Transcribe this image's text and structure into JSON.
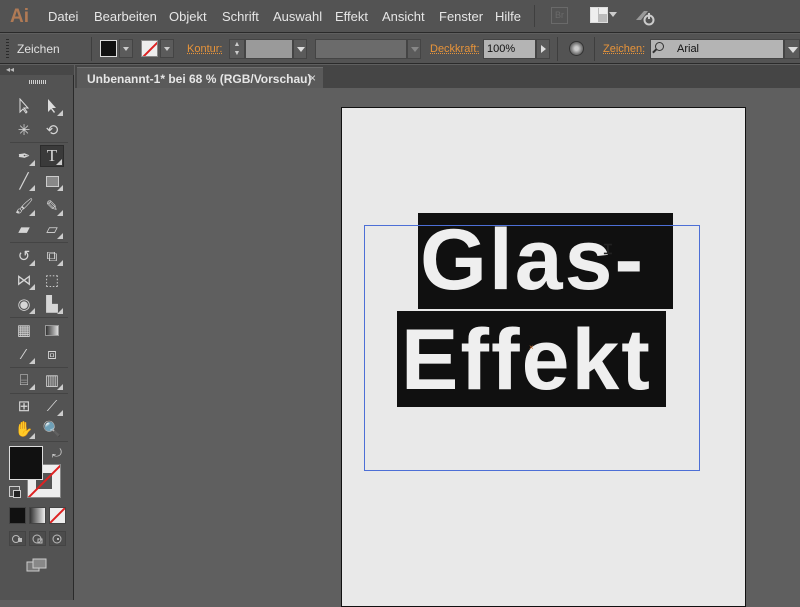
{
  "app": {
    "logo": "Ai"
  },
  "menu": {
    "items": [
      "Datei",
      "Bearbeiten",
      "Objekt",
      "Schrift",
      "Auswahl",
      "Effekt",
      "Ansicht",
      "Fenster",
      "Hilfe"
    ],
    "bridge": "Br"
  },
  "control_bar": {
    "label": "Zeichen",
    "fill_color": "#111111",
    "stroke_color": "none",
    "kontur_label": "Kontur:",
    "kontur_value": "",
    "deckkraft_label": "Deckkraft:",
    "deckkraft_value": "100%",
    "zeichen_label": "Zeichen:",
    "font_value": "Arial"
  },
  "tools_panel": {
    "collapse": "◂◂",
    "tools": [
      "selection-tool",
      "direct-selection-tool",
      "magic-wand-tool",
      "lasso-tool",
      "pen-tool",
      "type-tool",
      "line-tool",
      "rectangle-tool",
      "paintbrush-tool",
      "pencil-tool",
      "blob-brush-tool",
      "eraser-tool",
      "rotate-tool",
      "scale-tool",
      "width-tool",
      "free-transform-tool",
      "shape-builder-tool",
      "perspective-grid-tool",
      "mesh-tool",
      "gradient-tool",
      "eyedropper-tool",
      "blend-tool",
      "symbol-sprayer-tool",
      "column-graph-tool",
      "artboard-tool",
      "slice-tool",
      "hand-tool",
      "zoom-tool"
    ],
    "active_tool": "type-tool",
    "fill_color": "#111111",
    "stroke_color": "none"
  },
  "document": {
    "tab_title": "Unbenannt-1* bei 68 % (RGB/Vorschau)",
    "close": "×"
  },
  "artwork": {
    "line1": "Glas-",
    "line2": "Effekt",
    "text_color": "#efefef",
    "bg_color": "#101010"
  },
  "colors": {
    "accent_label": "#e8943a",
    "selection": "#4d6fd6"
  }
}
